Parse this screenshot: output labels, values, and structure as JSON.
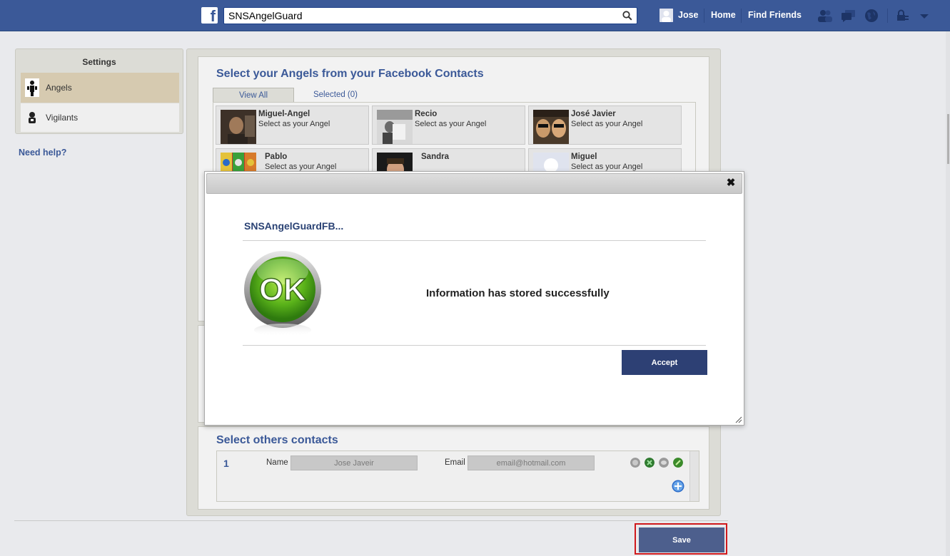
{
  "topbar": {
    "search_value": "SNSAngelGuard",
    "user_name": "Jose",
    "home": "Home",
    "find_friends": "Find Friends"
  },
  "settings": {
    "title": "Settings",
    "items": [
      {
        "label": "Angels",
        "icon": "angel-icon",
        "active": true
      },
      {
        "label": "Vigilants",
        "icon": "vigilant-icon",
        "active": false
      }
    ],
    "need_help": "Need help?"
  },
  "main": {
    "title": "Select your Angels from your Facebook Contacts",
    "tabs": [
      {
        "label": "View All",
        "active": true
      },
      {
        "label": "Selected (0)",
        "active": false
      }
    ],
    "contacts": [
      {
        "name": "Miguel-Angel",
        "action": "Select as your Angel"
      },
      {
        "name": "Recio",
        "action": "Select as your Angel"
      },
      {
        "name": "José Javier",
        "action": "Select as your Angel"
      },
      {
        "name": "Pablo",
        "action": "Select as your Angel"
      },
      {
        "name": "Sandra",
        "action": ""
      },
      {
        "name": "Miguel",
        "action": "Select as your Angel"
      }
    ]
  },
  "others": {
    "title": "Select others contacts",
    "row_number": "1",
    "name_label": "Name",
    "name_value": "Jose Javeir",
    "email_label": "Email",
    "email_value": "email@hotmail.com"
  },
  "save_label": "Save",
  "modal": {
    "app_name": "SNSAngelGuardFB...",
    "message": "Information has stored successfully",
    "accept_label": "Accept",
    "close_label": "✖",
    "icon_text": "OK"
  },
  "colors": {
    "brand": "#3b5998",
    "accept": "#2d4074",
    "highlight": "#d0191c"
  }
}
